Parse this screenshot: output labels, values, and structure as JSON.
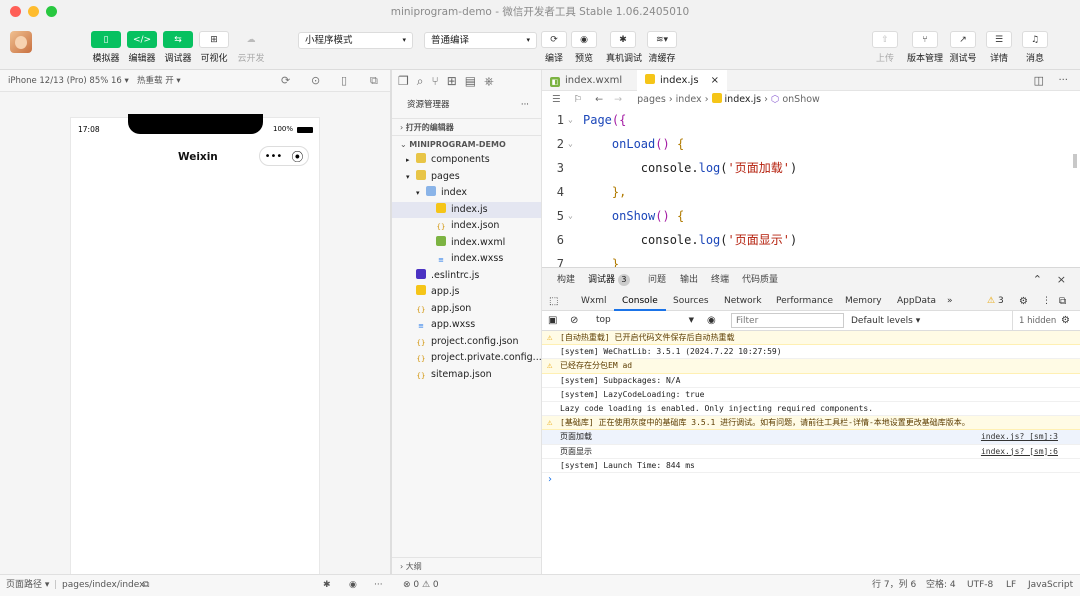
{
  "window": {
    "title": "miniprogram-demo - 微信开发者工具 Stable 1.06.2405010"
  },
  "toolbar": {
    "left_buttons": [
      {
        "label": "模拟器",
        "icon": "phone-icon"
      },
      {
        "label": "编辑器",
        "icon": "code-icon"
      },
      {
        "label": "调试器",
        "icon": "debug-icon"
      },
      {
        "label": "可视化",
        "icon": "layout-icon"
      },
      {
        "label": "云开发",
        "icon": "cloud-icon"
      }
    ],
    "mode_select": "小程序模式",
    "compile_select": "普通编译",
    "mid_buttons": [
      {
        "label": "编译",
        "icon": "refresh-icon"
      },
      {
        "label": "预览",
        "icon": "eye-icon"
      },
      {
        "label": "真机调试",
        "icon": "bug-icon"
      },
      {
        "label": "清缓存",
        "icon": "layers-icon"
      }
    ],
    "right_buttons": [
      {
        "label": "上传",
        "icon": "upload-icon"
      },
      {
        "label": "版本管理",
        "icon": "branch-icon"
      },
      {
        "label": "测试号",
        "icon": "external-icon"
      },
      {
        "label": "详情",
        "icon": "menu-icon"
      },
      {
        "label": "消息",
        "icon": "bell-icon"
      }
    ]
  },
  "simulator": {
    "device": "iPhone 12/13 (Pro) 85% 16 ▾",
    "hot_reload": "热重载 开 ▾",
    "status_time": "17:08",
    "battery": "100%",
    "nav_title": "Weixin",
    "capsule_dots": "•••",
    "capsule_circle": "⦿"
  },
  "explorer": {
    "title": "资源管理器",
    "more": "···",
    "open_editors": "打开的编辑器",
    "project": "MINIPROGRAM-DEMO",
    "tree": [
      {
        "name": "components",
        "indent": 1,
        "arrow": "▸",
        "icon": "folder"
      },
      {
        "name": "pages",
        "indent": 1,
        "arrow": "▾",
        "icon": "folder"
      },
      {
        "name": "index",
        "indent": 2,
        "arrow": "▾",
        "icon": "folder-open"
      },
      {
        "name": "index.js",
        "indent": 3,
        "arrow": "",
        "icon": "js",
        "active": true
      },
      {
        "name": "index.json",
        "indent": 3,
        "arrow": "",
        "icon": "json"
      },
      {
        "name": "index.wxml",
        "indent": 3,
        "arrow": "",
        "icon": "wxml"
      },
      {
        "name": "index.wxss",
        "indent": 3,
        "arrow": "",
        "icon": "wxss"
      },
      {
        "name": ".eslintrc.js",
        "indent": 1,
        "arrow": "",
        "icon": "eslint"
      },
      {
        "name": "app.js",
        "indent": 1,
        "arrow": "",
        "icon": "js"
      },
      {
        "name": "app.json",
        "indent": 1,
        "arrow": "",
        "icon": "json"
      },
      {
        "name": "app.wxss",
        "indent": 1,
        "arrow": "",
        "icon": "wxss"
      },
      {
        "name": "project.config.json",
        "indent": 1,
        "arrow": "",
        "icon": "json"
      },
      {
        "name": "project.private.config...",
        "indent": 1,
        "arrow": "",
        "icon": "json"
      },
      {
        "name": "sitemap.json",
        "indent": 1,
        "arrow": "",
        "icon": "json"
      }
    ],
    "outline": "大纲"
  },
  "editor": {
    "tabs": [
      {
        "label": "index.wxml"
      },
      {
        "label": "index.js",
        "close": "×"
      }
    ],
    "breadcrumb": [
      "pages",
      "index",
      "index.js",
      "onShow"
    ],
    "lines": [
      {
        "n": "1",
        "fold": "⌄"
      },
      {
        "n": "2",
        "fold": "⌄"
      },
      {
        "n": "3",
        "fold": ""
      },
      {
        "n": "4",
        "fold": ""
      },
      {
        "n": "5",
        "fold": "⌄"
      },
      {
        "n": "6",
        "fold": ""
      },
      {
        "n": "7",
        "fold": ""
      }
    ],
    "code": {
      "l1_a": "Page",
      "l1_b": "({",
      "l2_a": "onLoad",
      "l2_b": "() ",
      "l2_c": "{",
      "l3_a": "console",
      "l3_b": ".",
      "l3_c": "log",
      "l3_d": "(",
      "l3_e": "'页面加载'",
      "l3_f": ")",
      "l4": "},",
      "l5_a": "onShow",
      "l5_b": "() ",
      "l5_c": "{",
      "l6_a": "console",
      "l6_b": ".",
      "l6_c": "log",
      "l6_d": "(",
      "l6_e": "'页面显示'",
      "l6_f": ")",
      "l7": "}"
    }
  },
  "devtools": {
    "top_tabs": [
      "构建",
      "调试器",
      "问题",
      "输出",
      "终端",
      "代码质量"
    ],
    "debugger_badge": "3",
    "tabs": [
      "Wxml",
      "Console",
      "Sources",
      "Network",
      "Performance",
      "Memory",
      "AppData"
    ],
    "more": "»",
    "warn_count": "3",
    "context": "top",
    "filter_placeholder": "Filter",
    "levels": "Default levels ▾",
    "hidden": "1 hidden",
    "logs": [
      {
        "text": "[自动热重载] 已开启代码文件保存后自动热重载",
        "warn": true,
        "src": ""
      },
      {
        "text": "[system] WeChatLib: 3.5.1 (2024.7.22 10:27:59)",
        "warn": false,
        "src": ""
      },
      {
        "text": "已经存在分包EM ad",
        "warn": true,
        "src": ""
      },
      {
        "text": "[system] Subpackages: N/A",
        "warn": false,
        "src": ""
      },
      {
        "text": "[system] LazyCodeLoading: true",
        "warn": false,
        "src": ""
      },
      {
        "text": "Lazy code loading is enabled. Only injecting required components.",
        "warn": false,
        "src": ""
      },
      {
        "text": "[基础库] 正在使用灰度中的基础库 3.5.1 进行调试。如有问题，请前往工具栏-详情-本地设置更改基础库版本。",
        "warn": true,
        "src": ""
      },
      {
        "text": "页面加载",
        "warn": false,
        "src": "index.js? [sm]:3",
        "sel": true
      },
      {
        "text": "页面显示",
        "warn": false,
        "src": "index.js? [sm]:6"
      },
      {
        "text": "[system] Launch Time: 844 ms",
        "warn": false,
        "src": ""
      }
    ],
    "prompt": "›"
  },
  "statusbar": {
    "left": "页面路径 ▾",
    "path": "pages/index/index",
    "problems": "⊗ 0 ⚠ 0",
    "position": "行 7，列 6",
    "spaces": "空格: 4",
    "encoding": "UTF-8",
    "eol": "LF",
    "lang": "JavaScript"
  },
  "colors": {
    "accent": "#07c160",
    "close": "#ff5f57",
    "minimize": "#febc2e",
    "maximize": "#28c840"
  }
}
